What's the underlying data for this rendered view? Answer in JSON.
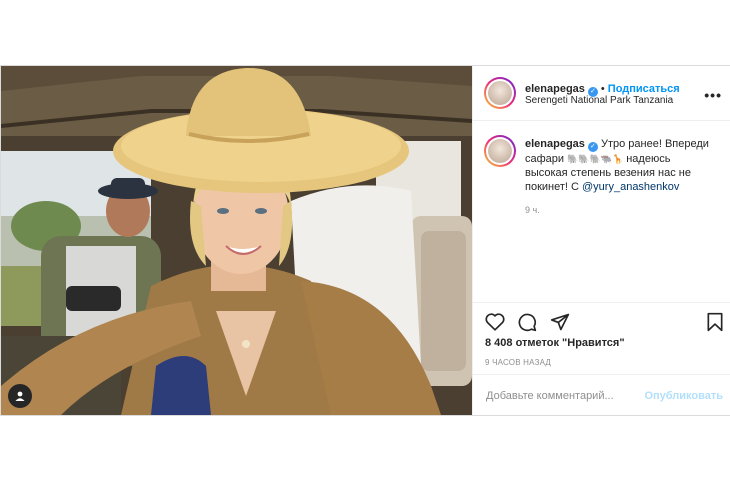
{
  "header": {
    "username": "elenapegas",
    "follow_label": "Подписаться",
    "location": "Serengeti National Park Tanzania",
    "more_label": "•••"
  },
  "caption": {
    "username": "elenapegas",
    "text_line1": "Утро ранее! Впереди",
    "text_line2": "сафари",
    "emojis": "🐘🐘🐘🐃🦒",
    "text_line2_rest": "надеюсь",
    "text_line3": "высокая степень везения нас не",
    "text_line4": "покинет! С",
    "mention": "@yury_anashenkov",
    "time": "9 ч."
  },
  "actions": {
    "likes": "8 408 отметок \"Нравится\"",
    "posted_ago": "9 ЧАСОВ НАЗАД"
  },
  "comment": {
    "placeholder": "Добавьте комментарий...",
    "publish_label": "Опубликовать"
  },
  "colors": {
    "accent": "#0095f6",
    "verified": "#3897f0"
  },
  "icons": [
    "verified-icon",
    "heart-icon",
    "comment-icon",
    "share-icon",
    "bookmark-icon",
    "user-tag-icon",
    "more-icon"
  ]
}
